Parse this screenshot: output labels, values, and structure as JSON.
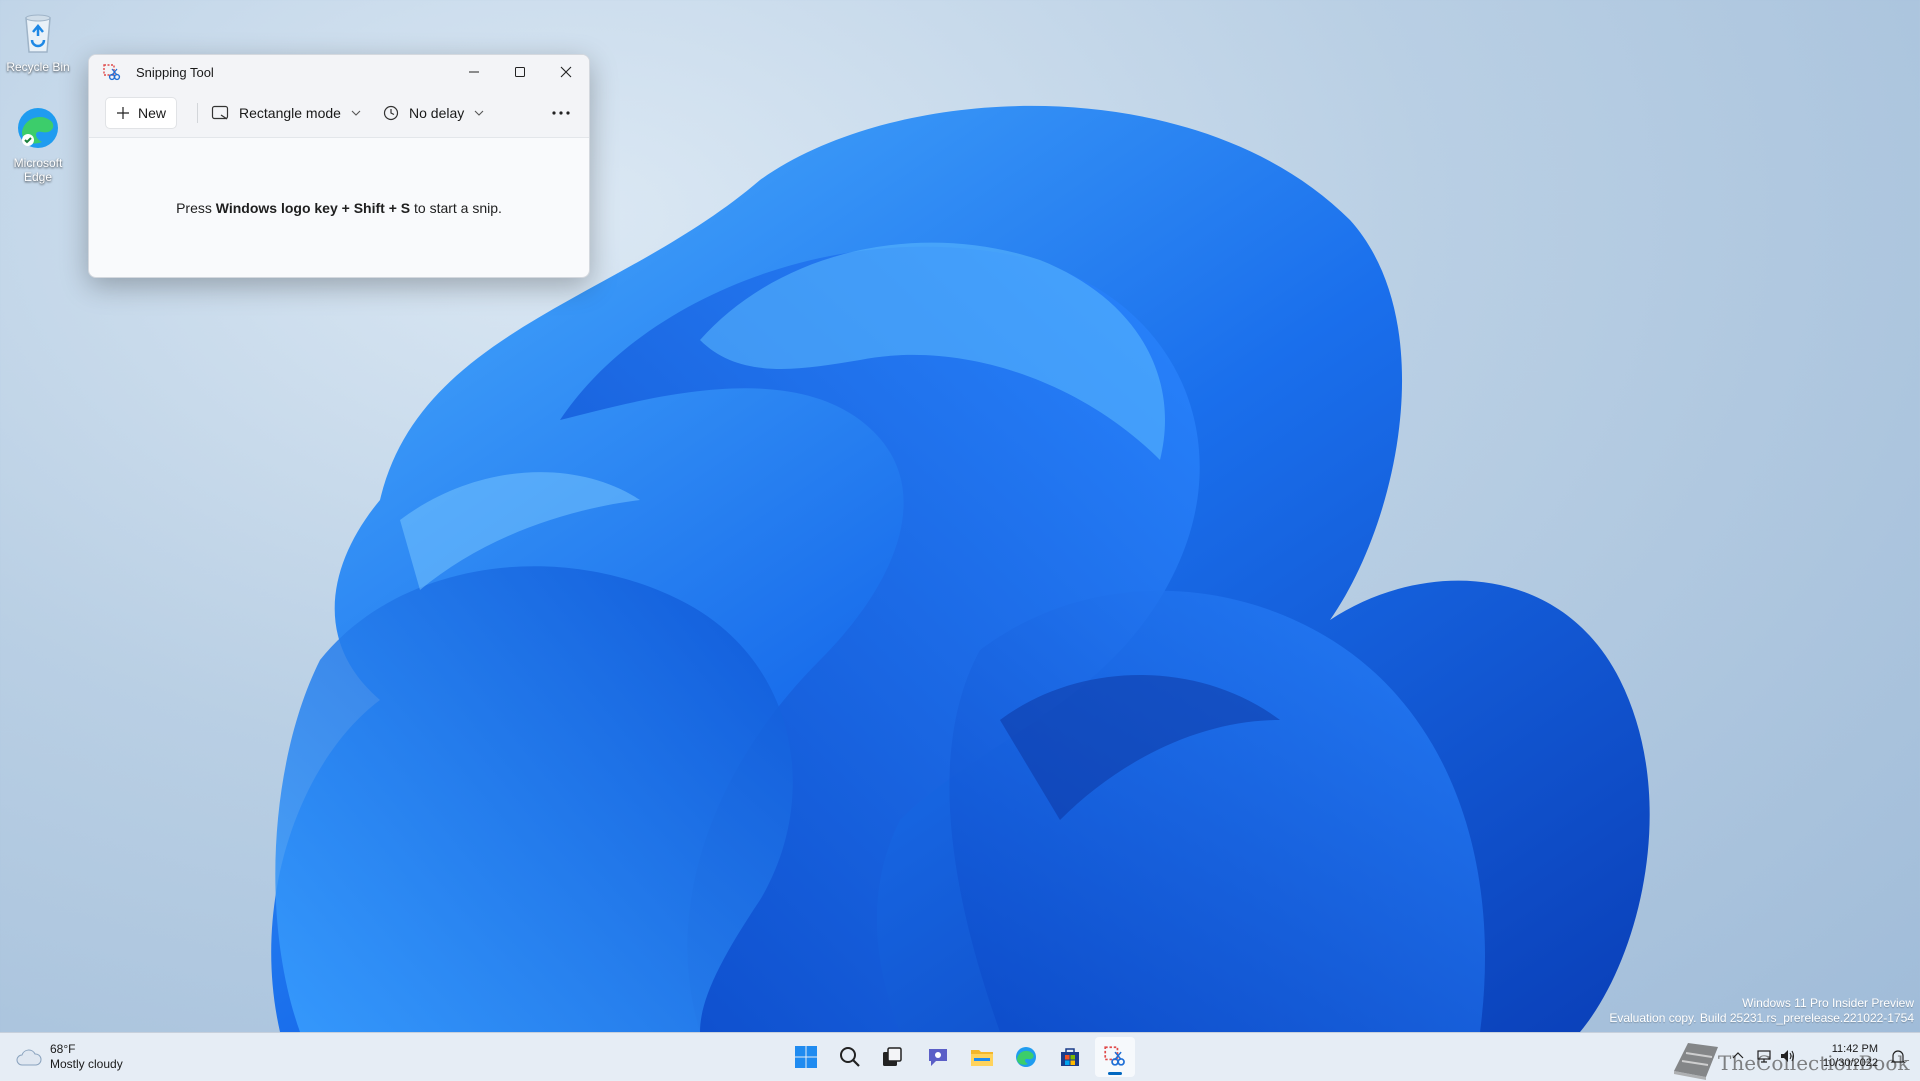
{
  "desktop": {
    "icons": [
      {
        "label": "Recycle Bin",
        "icon": "recycle-bin-icon"
      },
      {
        "label": "Microsoft Edge",
        "icon": "edge-icon"
      }
    ],
    "watermark": {
      "line1": "Windows 11 Pro Insider Preview",
      "line2": "Evaluation copy. Build 25231.rs_prerelease.221022-1754"
    }
  },
  "snipping_tool": {
    "title": "Snipping Tool",
    "app_icon": "snipping-tool-icon",
    "controls": {
      "minimize": "minimize-icon",
      "maximize": "maximize-icon",
      "close": "close-icon"
    },
    "toolbar": {
      "new_label": "New",
      "mode_label": "Rectangle mode",
      "delay_label": "No delay",
      "more_icon": "more-options-icon"
    },
    "body": {
      "prefix": "Press ",
      "shortcut": "Windows logo key + Shift + S",
      "suffix": " to start a snip."
    }
  },
  "taskbar": {
    "weather": {
      "temperature": "68°F",
      "condition": "Mostly cloudy",
      "icon": "cloud-icon"
    },
    "apps": [
      {
        "name": "Start",
        "icon": "windows-start-icon"
      },
      {
        "name": "Search",
        "icon": "search-icon"
      },
      {
        "name": "Task View",
        "icon": "task-view-icon"
      },
      {
        "name": "Chat",
        "icon": "chat-icon"
      },
      {
        "name": "File Explorer",
        "icon": "folder-icon"
      },
      {
        "name": "Microsoft Edge",
        "icon": "edge-icon"
      },
      {
        "name": "Microsoft Store",
        "icon": "store-icon"
      },
      {
        "name": "Snipping Tool",
        "icon": "snipping-tool-icon",
        "active": true
      }
    ],
    "clock": {
      "time": "11:42 PM",
      "date": "10/30/2022"
    },
    "overlay_text": "TheCollectionBook"
  },
  "colors": {
    "accent": "#0067c0",
    "wallpaper_blue": "#1565e0"
  }
}
